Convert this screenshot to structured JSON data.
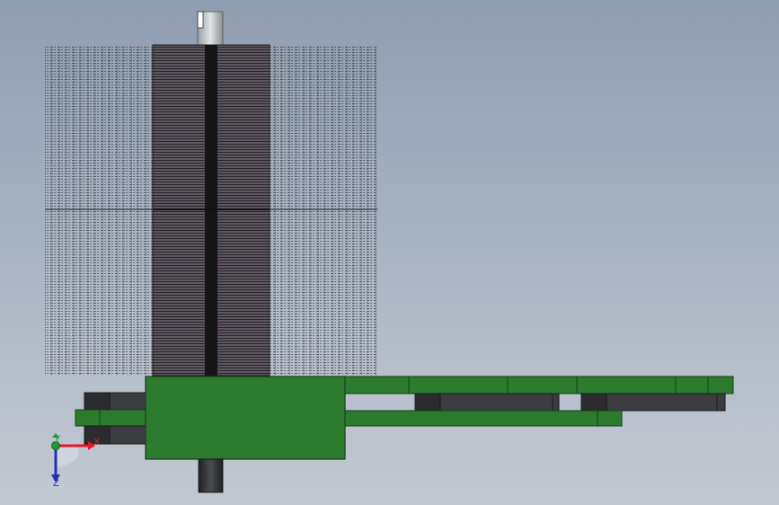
{
  "viewport": {
    "background_top": "#8f9db0",
    "background_bottom": "#c3c9d2"
  },
  "model": {
    "colors": {
      "green_part": "#2c7a2e",
      "green_edge": "#1a3d1a",
      "dark_part": "#3a3c3f",
      "shaft_gray": "#cfd2d6",
      "coil_line": "#111111"
    }
  },
  "triad": {
    "x_label": "X",
    "y_label": "Y",
    "z_label": "Z",
    "x_color": "#e8162a",
    "y_color": "#1c9b2f",
    "z_color": "#2230b8"
  }
}
